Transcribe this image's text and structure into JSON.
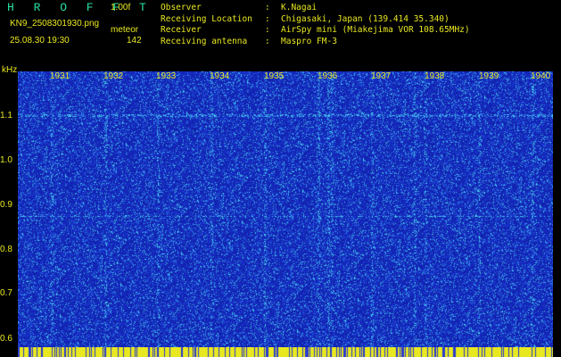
{
  "header": {
    "app_title": "H R O F F T",
    "version": "1.00f",
    "filename": "KN9_2508301930.png",
    "meteor_label": "meteor",
    "datetime": "25.08.30 19:30",
    "meteor_count": "142"
  },
  "info": [
    {
      "key": "Observer",
      "sep": ":",
      "value": "K.Nagai"
    },
    {
      "key": "Receiving Location",
      "sep": ":",
      "value": "Chigasaki, Japan (139.414 35.340)"
    },
    {
      "key": "Receiver",
      "sep": ":",
      "value": "AirSpy mini (Miakejima VOR 108.65MHz)"
    },
    {
      "key": "Receiving antenna",
      "sep": ":",
      "value": "Maspro FM-3"
    }
  ],
  "axis": {
    "unit": "kHz",
    "y_ticks": [
      "1.1",
      "1.0",
      "0.9",
      "0.8",
      "0.7",
      "0.6"
    ],
    "x_ticks": [
      "1931",
      "1932",
      "1933",
      "1934",
      "1935",
      "1936",
      "1937",
      "1938",
      "1939",
      "1940"
    ]
  },
  "colors": {
    "background": "#000000",
    "text": "#e8e820",
    "title": "#27e0a0",
    "spectrum_base": "#1428c8",
    "spectrum_bright": "#3cc8f0",
    "bottom_bar": "#e8e820"
  }
}
